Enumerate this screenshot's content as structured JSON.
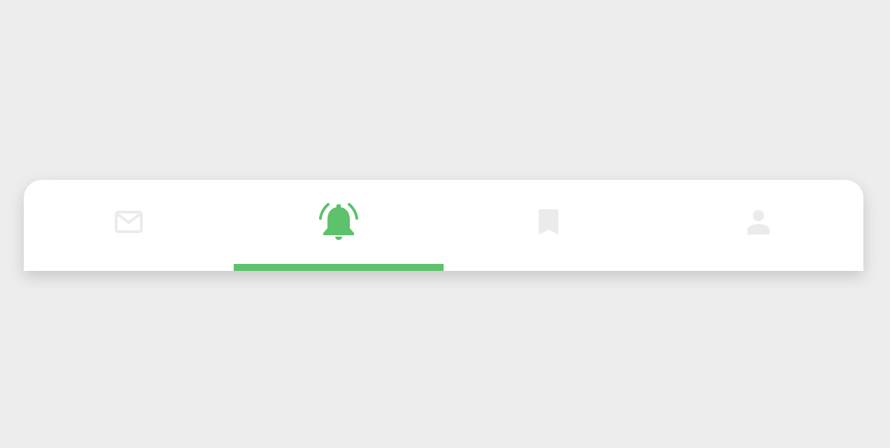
{
  "colors": {
    "page_background": "#ededed",
    "bar_background": "#ffffff",
    "active": "#5ec16b",
    "inactive": "#ebebeb"
  },
  "tabbar": {
    "active_index": 1,
    "tabs": [
      {
        "icon": "mail-icon",
        "active": false
      },
      {
        "icon": "bell-ringing-icon",
        "active": true
      },
      {
        "icon": "bookmark-icon",
        "active": false
      },
      {
        "icon": "person-icon",
        "active": false
      }
    ]
  }
}
